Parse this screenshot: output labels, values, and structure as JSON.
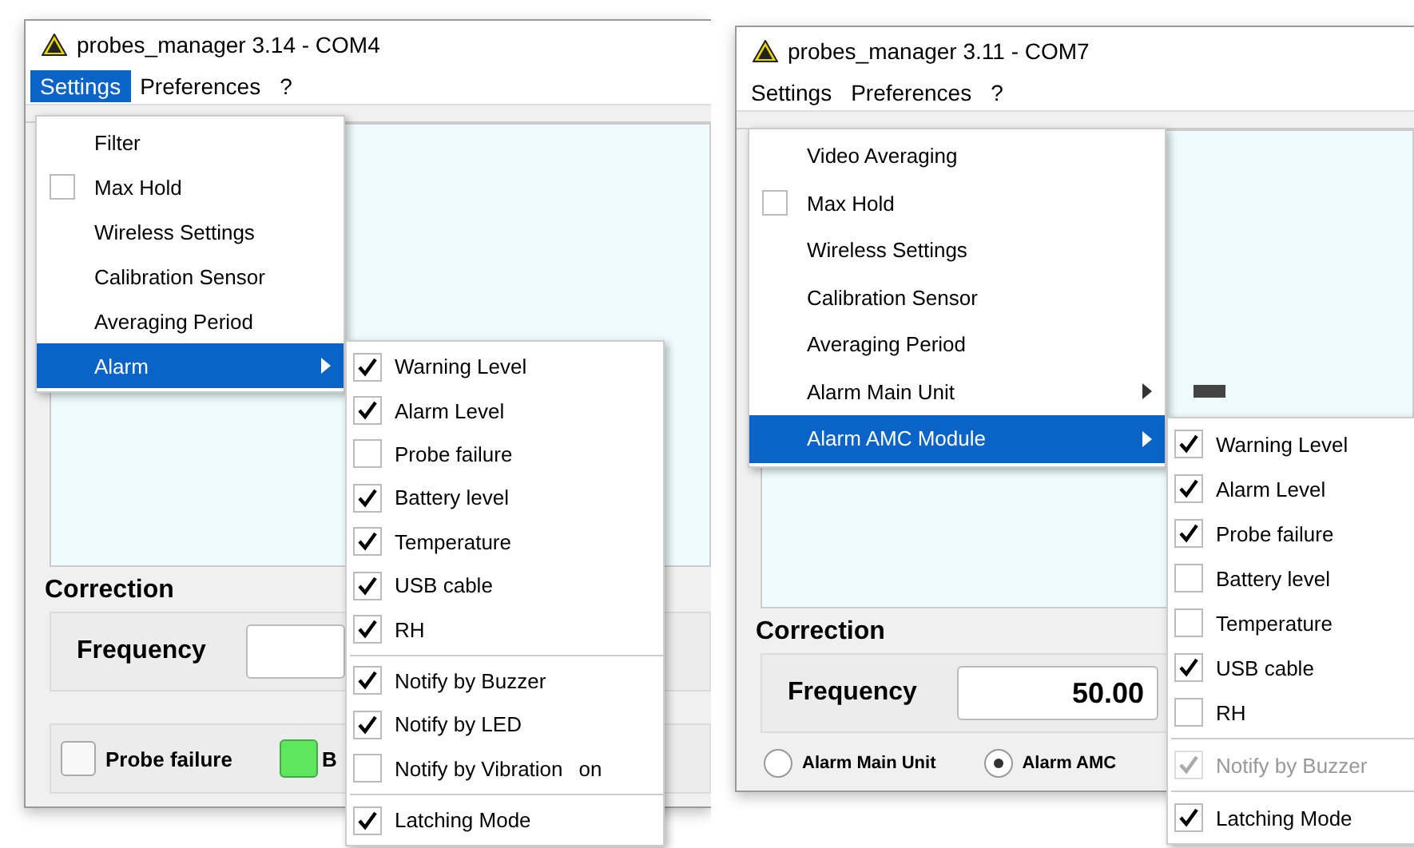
{
  "panels": [
    {
      "window": {
        "title": "probes_manager 3.14 - COM4"
      },
      "menu_bar": [
        {
          "label": "Settings",
          "selected": true
        },
        {
          "label": "Preferences",
          "selected": false
        },
        {
          "label": "?",
          "selected": false
        }
      ],
      "dropdown": [
        {
          "kind": "plain",
          "label": "Filter",
          "selected": false
        },
        {
          "kind": "check",
          "label": "Max Hold",
          "checked": false,
          "selected": false
        },
        {
          "kind": "plain",
          "label": "Wireless Settings",
          "selected": false
        },
        {
          "kind": "plain",
          "label": "Calibration Sensor",
          "selected": false
        },
        {
          "kind": "plain",
          "label": "Averaging Period",
          "selected": false
        },
        {
          "kind": "submenu",
          "label": "Alarm",
          "selected": true
        }
      ],
      "submenu": [
        {
          "kind": "check",
          "label": "Warning Level",
          "checked": true,
          "disabled": false
        },
        {
          "kind": "check",
          "label": "Alarm Level",
          "checked": true,
          "disabled": false
        },
        {
          "kind": "check",
          "label": "Probe failure",
          "checked": false,
          "disabled": false
        },
        {
          "kind": "check",
          "label": "Battery level",
          "checked": true,
          "disabled": false
        },
        {
          "kind": "check",
          "label": "Temperature",
          "checked": true,
          "disabled": false
        },
        {
          "kind": "check",
          "label": "USB cable",
          "checked": true,
          "disabled": false
        },
        {
          "kind": "check",
          "label": "RH",
          "checked": true,
          "disabled": false
        },
        {
          "kind": "separator"
        },
        {
          "kind": "check",
          "label": "Notify by Buzzer",
          "checked": true,
          "disabled": false
        },
        {
          "kind": "check",
          "label": "Notify by LED",
          "checked": true,
          "disabled": false
        },
        {
          "kind": "check",
          "label": "Notify by Vibration",
          "checked": false,
          "disabled": false,
          "trailing_text": "on"
        },
        {
          "kind": "separator"
        },
        {
          "kind": "check",
          "label": "Latching Mode",
          "checked": true,
          "disabled": false
        }
      ],
      "correction": {
        "title": "Correction",
        "frequency_label": "Frequency"
      },
      "bottom": [
        {
          "kind": "checkbox",
          "label": "Probe failure",
          "checked": false
        },
        {
          "kind": "indicator",
          "label": "B",
          "color": "#5ee65e"
        }
      ]
    },
    {
      "window": {
        "title": "probes_manager 3.11 - COM7"
      },
      "menu_bar": [
        {
          "label": "Settings",
          "selected": false
        },
        {
          "label": "Preferences",
          "selected": false
        },
        {
          "label": "?",
          "selected": false
        }
      ],
      "dropdown": [
        {
          "kind": "plain",
          "label": "Video Averaging",
          "selected": false
        },
        {
          "kind": "check",
          "label": "Max Hold",
          "checked": false,
          "selected": false
        },
        {
          "kind": "plain",
          "label": "Wireless Settings",
          "selected": false
        },
        {
          "kind": "plain",
          "label": "Calibration Sensor",
          "selected": false
        },
        {
          "kind": "plain",
          "label": "Averaging Period",
          "selected": false
        },
        {
          "kind": "submenu",
          "label": "Alarm Main Unit",
          "selected": false
        },
        {
          "kind": "submenu",
          "label": "Alarm AMC Module",
          "selected": true
        }
      ],
      "submenu": [
        {
          "kind": "check",
          "label": "Warning Level",
          "checked": true,
          "disabled": false
        },
        {
          "kind": "check",
          "label": "Alarm Level",
          "checked": true,
          "disabled": false
        },
        {
          "kind": "check",
          "label": "Probe failure",
          "checked": true,
          "disabled": false
        },
        {
          "kind": "check",
          "label": "Battery level",
          "checked": false,
          "disabled": false
        },
        {
          "kind": "check",
          "label": "Temperature",
          "checked": false,
          "disabled": false
        },
        {
          "kind": "check",
          "label": "USB cable",
          "checked": true,
          "disabled": false
        },
        {
          "kind": "check",
          "label": "RH",
          "checked": false,
          "disabled": false
        },
        {
          "kind": "separator"
        },
        {
          "kind": "check",
          "label": "Notify by Buzzer",
          "checked": true,
          "disabled": true
        },
        {
          "kind": "separator"
        },
        {
          "kind": "check",
          "label": "Latching Mode",
          "checked": true,
          "disabled": false
        }
      ],
      "correction": {
        "title": "Correction",
        "frequency_label": "Frequency",
        "frequency_value": "50.00"
      },
      "bottom": [
        {
          "kind": "radio",
          "label": "Alarm Main Unit",
          "selected": false
        },
        {
          "kind": "radio",
          "label": "Alarm AMC",
          "selected": true
        }
      ]
    }
  ]
}
